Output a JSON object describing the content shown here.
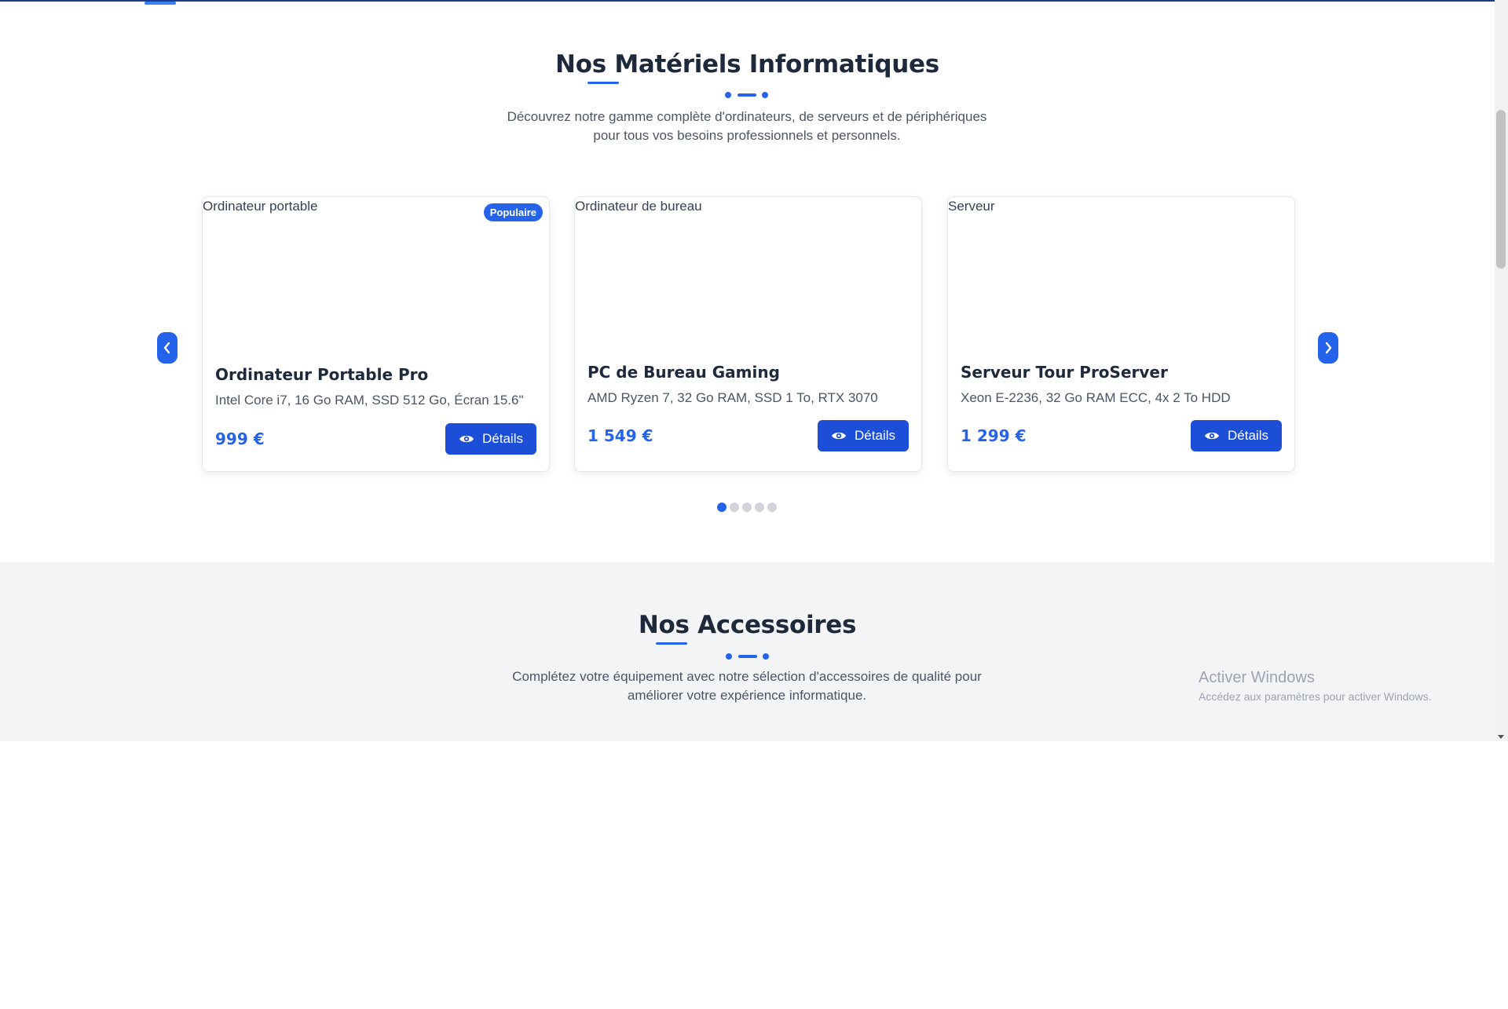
{
  "materials": {
    "title": "Nos Matériels Informatiques",
    "subtitle_line1": "Découvrez notre gamme complète d'ordinateurs, de serveurs et de périphériques",
    "subtitle_line2": "pour tous vos besoins professionnels et personnels.",
    "products": [
      {
        "image_alt": "Ordinateur portable",
        "badge": "Populaire",
        "name": "Ordinateur Portable Pro",
        "specs": "Intel Core i7, 16 Go RAM, SSD 512 Go, Écran 15.6\"",
        "price": "999 €",
        "button": "Détails"
      },
      {
        "image_alt": "Ordinateur de bureau",
        "name": "PC de Bureau Gaming",
        "specs": "AMD Ryzen 7, 32 Go RAM, SSD 1 To, RTX 3070",
        "price": "1 549 €",
        "button": "Détails"
      },
      {
        "image_alt": "Serveur",
        "name": "Serveur Tour ProServer",
        "specs": "Xeon E-2236, 32 Go RAM ECC, 4x 2 To HDD",
        "price": "1 299 €",
        "button": "Détails"
      }
    ],
    "pagination": {
      "total": 5,
      "active": 1
    }
  },
  "accessories": {
    "title": "Nos Accessoires",
    "subtitle_line1": "Complétez votre équipement avec notre sélection d'accessoires de qualité pour",
    "subtitle_line2": "améliorer votre expérience informatique."
  },
  "watermark": {
    "line1": "Activer Windows",
    "line2": "Accédez aux paramètres pour activer Windows."
  },
  "icons": {
    "prev": "chevron-left-icon",
    "next": "chevron-right-icon",
    "details": "eye-icon"
  },
  "colors": {
    "accent": "#2563eb",
    "button": "#1d4ed8",
    "title": "#1e293b",
    "section_bg": "#f3f4f6"
  }
}
